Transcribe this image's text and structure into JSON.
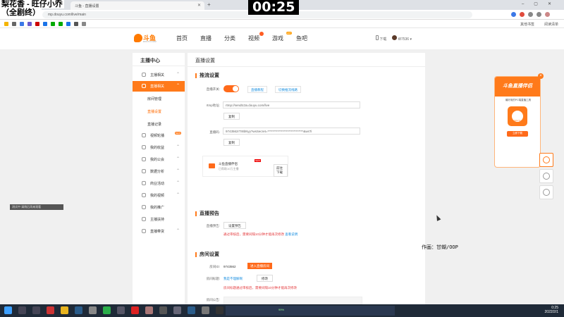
{
  "overlay": {
    "line1": "梨花香 - 旺仔小乔",
    "line2": "（全剧终）",
    "timer": "00:25",
    "author": "作画：甘蝴/OOP",
    "left_caption": "测试中 请稍后再来观看"
  },
  "browser": {
    "tab_title": "斗鱼 - 直播设置",
    "url": "mp.douyu.com/live/main",
    "bookmarks_right": [
      "其他书签",
      "阅读清单"
    ]
  },
  "site": {
    "brand": "斗鱼",
    "brand_sub": "DOUYU.COM",
    "nav": [
      "首页",
      "直播",
      "分类",
      "视频",
      "游戏",
      "鱼吧"
    ],
    "nav_hot": "HOT",
    "download": "下载",
    "username": "t87536"
  },
  "sidebar": {
    "title": "主播中心",
    "items": [
      {
        "label": "主播相关"
      },
      {
        "label": "直播相关"
      },
      {
        "label": "视频轮播"
      },
      {
        "label": "我的收益"
      },
      {
        "label": "我的公会"
      },
      {
        "label": "数据分析"
      },
      {
        "label": "商业活动"
      },
      {
        "label": "我的视频"
      },
      {
        "label": "我的推广"
      },
      {
        "label": "主播扶持"
      },
      {
        "label": "直播带货"
      }
    ],
    "subitems": [
      "房间管理",
      "直播设置",
      "直播记录"
    ],
    "new_badge": "NEW"
  },
  "main": {
    "title": "直播设置",
    "stream": {
      "heading": "推流设置",
      "switch_label": "直播开关:",
      "btn_tutorial": "直播教程",
      "btn_switch_line": "切换推流线路",
      "rtmp_label": "rtmp地址:",
      "rtmp_value": "rtmp://sendtc3a.douyu.com/live",
      "copy": "复制",
      "code_label": "直播码:",
      "code_value": "9743562rTr8bNyy?wsSecret=*****************************&wsTi"
    },
    "promo": {
      "title": "斗鱼直播伴侣",
      "subtitle": "已帮助10万主播",
      "new": "NEW",
      "download": "前往下载"
    },
    "preview": {
      "heading": "直播预告",
      "label": "直播预告:",
      "btn": "设置预告",
      "warn": "通过审核后，需要间隔10分钟才能再次修改",
      "link": "查看说明"
    },
    "room": {
      "heading": "房间设置",
      "id_label": "房间ID:",
      "id_value": "9743562",
      "enter_btn": "进入直播房间",
      "title_label": "房间标题:",
      "title_value": "我是不理解啊",
      "edit": "修改",
      "warn": "房间标题通过审核后，需要间隔10分钟才能再次修改",
      "notice_label": "房间公告:"
    }
  },
  "ad": {
    "title": "斗鱼直播伴侣",
    "desc": "最好用的PC端直播工具",
    "app_name": "DOUYU",
    "cta": "立即下载"
  },
  "taskbar": {
    "progress": "99%",
    "time": "0:25",
    "date": "2022/2/1"
  }
}
